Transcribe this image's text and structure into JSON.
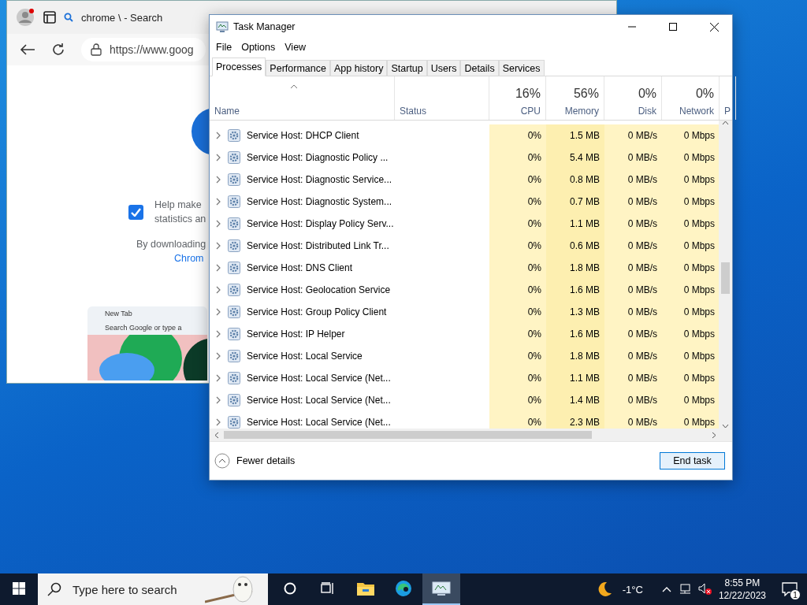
{
  "browser": {
    "tab_title": "chrome \\ - Search",
    "url": "https://www.goog",
    "consent": {
      "checked": true,
      "line_1": "Help make",
      "line_2": "statistics an"
    },
    "download_note": "By downloading",
    "link": "Chrom",
    "preview": {
      "tab": "New Tab",
      "search": "Search Google or type a"
    }
  },
  "task_manager": {
    "title": "Task Manager",
    "menu": [
      "File",
      "Options",
      "View"
    ],
    "tabs": [
      {
        "label": "Processes",
        "selected": true
      },
      {
        "label": "Performance",
        "selected": false
      },
      {
        "label": "App history",
        "selected": false
      },
      {
        "label": "Startup",
        "selected": false
      },
      {
        "label": "Users",
        "selected": false
      },
      {
        "label": "Details",
        "selected": false
      },
      {
        "label": "Services",
        "selected": false
      }
    ],
    "columns": [
      {
        "label": "Name",
        "kind": "name"
      },
      {
        "label": "Status",
        "kind": "text"
      },
      {
        "label": "CPU",
        "percent": "16%",
        "kind": "metric"
      },
      {
        "label": "Memory",
        "percent": "56%",
        "kind": "metric"
      },
      {
        "label": "Disk",
        "percent": "0%",
        "kind": "metric"
      },
      {
        "label": "Network",
        "percent": "0%",
        "kind": "metric"
      },
      {
        "label": "P",
        "kind": "cut"
      }
    ],
    "rows": [
      {
        "name": "Service Host: DHCP Client",
        "cpu": "0%",
        "memory": "1.5 MB",
        "disk": "0 MB/s",
        "network": "0 Mbps"
      },
      {
        "name": "Service Host: Diagnostic Policy ...",
        "cpu": "0%",
        "memory": "5.4 MB",
        "disk": "0 MB/s",
        "network": "0 Mbps"
      },
      {
        "name": "Service Host: Diagnostic Service...",
        "cpu": "0%",
        "memory": "0.8 MB",
        "disk": "0 MB/s",
        "network": "0 Mbps"
      },
      {
        "name": "Service Host: Diagnostic System...",
        "cpu": "0%",
        "memory": "0.7 MB",
        "disk": "0 MB/s",
        "network": "0 Mbps"
      },
      {
        "name": "Service Host: Display Policy Serv...",
        "cpu": "0%",
        "memory": "1.1 MB",
        "disk": "0 MB/s",
        "network": "0 Mbps"
      },
      {
        "name": "Service Host: Distributed Link Tr...",
        "cpu": "0%",
        "memory": "0.6 MB",
        "disk": "0 MB/s",
        "network": "0 Mbps"
      },
      {
        "name": "Service Host: DNS Client",
        "cpu": "0%",
        "memory": "1.8 MB",
        "disk": "0 MB/s",
        "network": "0 Mbps"
      },
      {
        "name": "Service Host: Geolocation Service",
        "cpu": "0%",
        "memory": "1.6 MB",
        "disk": "0 MB/s",
        "network": "0 Mbps"
      },
      {
        "name": "Service Host: Group Policy Client",
        "cpu": "0%",
        "memory": "1.3 MB",
        "disk": "0 MB/s",
        "network": "0 Mbps"
      },
      {
        "name": "Service Host: IP Helper",
        "cpu": "0%",
        "memory": "1.6 MB",
        "disk": "0 MB/s",
        "network": "0 Mbps"
      },
      {
        "name": "Service Host: Local Service",
        "cpu": "0%",
        "memory": "1.8 MB",
        "disk": "0 MB/s",
        "network": "0 Mbps"
      },
      {
        "name": "Service Host: Local Service (Net...",
        "cpu": "0%",
        "memory": "1.1 MB",
        "disk": "0 MB/s",
        "network": "0 Mbps"
      },
      {
        "name": "Service Host: Local Service (Net...",
        "cpu": "0%",
        "memory": "1.4 MB",
        "disk": "0 MB/s",
        "network": "0 Mbps"
      },
      {
        "name": "Service Host: Local Service (Net...",
        "cpu": "0%",
        "memory": "2.3 MB",
        "disk": "0 MB/s",
        "network": "0 Mbps"
      }
    ],
    "fewer_details": "Fewer details",
    "end_task": "End task"
  },
  "taskbar": {
    "search_placeholder": "Type here to search",
    "weather": "-1°C",
    "time": "8:55 PM",
    "date": "12/22/2023",
    "notifications": "1"
  }
}
